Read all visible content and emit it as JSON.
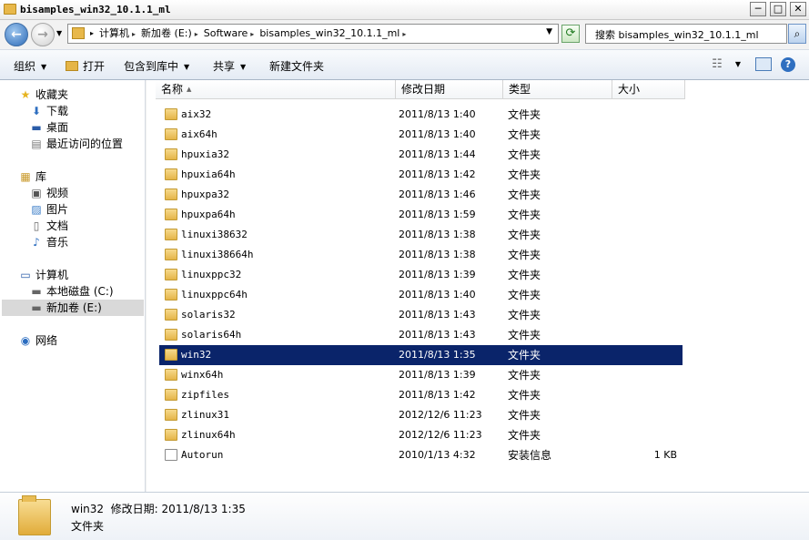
{
  "window": {
    "title": "bisamples_win32_10.1.1_ml",
    "min_glyph": "─",
    "max_glyph": "□",
    "close_glyph": "✕"
  },
  "address": {
    "crumbs": [
      "计算机",
      "新加卷 (E:)",
      "Software",
      "bisamples_win32_10.1.1_ml"
    ],
    "search_placeholder": "搜索 bisamples_win32_10.1.1_ml"
  },
  "toolbar": {
    "organize": "组织",
    "open": "打开",
    "include_library": "包含到库中",
    "share": "共享",
    "new_folder": "新建文件夹"
  },
  "nav": {
    "favorites": "收藏夹",
    "downloads": "下载",
    "desktop": "桌面",
    "recent": "最近访问的位置",
    "libraries": "库",
    "videos": "视频",
    "pictures": "图片",
    "documents": "文档",
    "music": "音乐",
    "computer": "计算机",
    "drive_c": "本地磁盘 (C:)",
    "drive_e": "新加卷 (E:)",
    "network": "网络"
  },
  "columns": {
    "name": "名称",
    "modified": "修改日期",
    "type": "类型",
    "size": "大小"
  },
  "files": [
    {
      "name": "aix32",
      "date": "2011/8/13 1:40",
      "type": "文件夹",
      "size": ""
    },
    {
      "name": "aix64h",
      "date": "2011/8/13 1:40",
      "type": "文件夹",
      "size": ""
    },
    {
      "name": "hpuxia32",
      "date": "2011/8/13 1:44",
      "type": "文件夹",
      "size": ""
    },
    {
      "name": "hpuxia64h",
      "date": "2011/8/13 1:42",
      "type": "文件夹",
      "size": ""
    },
    {
      "name": "hpuxpa32",
      "date": "2011/8/13 1:46",
      "type": "文件夹",
      "size": ""
    },
    {
      "name": "hpuxpa64h",
      "date": "2011/8/13 1:59",
      "type": "文件夹",
      "size": ""
    },
    {
      "name": "linuxi38632",
      "date": "2011/8/13 1:38",
      "type": "文件夹",
      "size": ""
    },
    {
      "name": "linuxi38664h",
      "date": "2011/8/13 1:38",
      "type": "文件夹",
      "size": ""
    },
    {
      "name": "linuxppc32",
      "date": "2011/8/13 1:39",
      "type": "文件夹",
      "size": ""
    },
    {
      "name": "linuxppc64h",
      "date": "2011/8/13 1:40",
      "type": "文件夹",
      "size": ""
    },
    {
      "name": "solaris32",
      "date": "2011/8/13 1:43",
      "type": "文件夹",
      "size": ""
    },
    {
      "name": "solaris64h",
      "date": "2011/8/13 1:43",
      "type": "文件夹",
      "size": ""
    },
    {
      "name": "win32",
      "date": "2011/8/13 1:35",
      "type": "文件夹",
      "size": ""
    },
    {
      "name": "winx64h",
      "date": "2011/8/13 1:39",
      "type": "文件夹",
      "size": ""
    },
    {
      "name": "zipfiles",
      "date": "2011/8/13 1:42",
      "type": "文件夹",
      "size": ""
    },
    {
      "name": "zlinux31",
      "date": "2012/12/6 11:23",
      "type": "文件夹",
      "size": ""
    },
    {
      "name": "zlinux64h",
      "date": "2012/12/6 11:23",
      "type": "文件夹",
      "size": ""
    },
    {
      "name": "Autorun",
      "date": "2010/1/13 4:32",
      "type": "安装信息",
      "size": "1 KB"
    }
  ],
  "selected": "win32",
  "details": {
    "name": "win32",
    "modified_label": "修改日期:",
    "modified": "2011/8/13 1:35",
    "type": "文件夹"
  },
  "colors": {
    "selection": "#0a246a",
    "folder": "#e5b548"
  }
}
